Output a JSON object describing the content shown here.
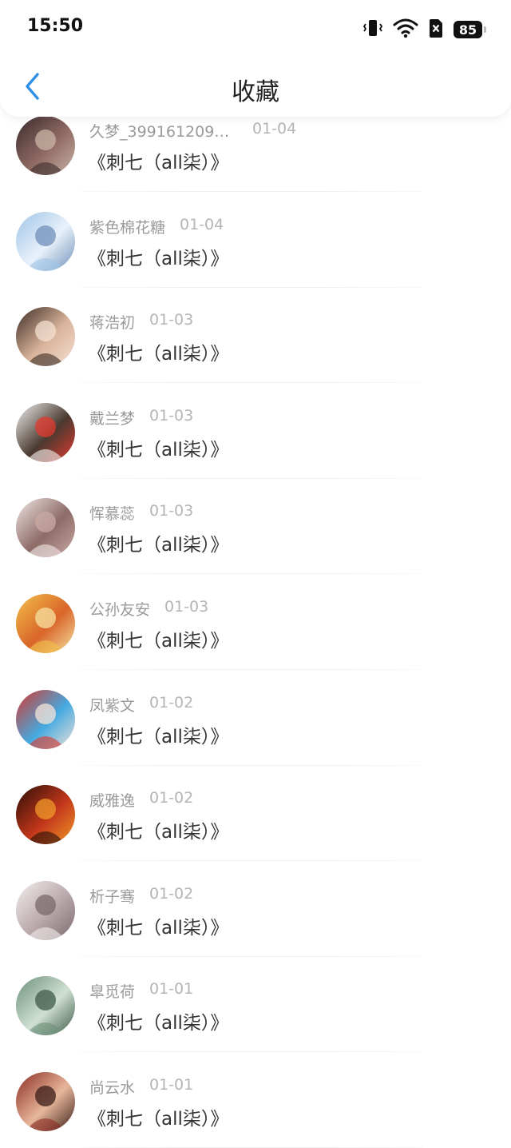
{
  "status_bar": {
    "time": "15:50",
    "battery": "85"
  },
  "header": {
    "title": "收藏"
  },
  "items": [
    {
      "username": "久梦_3991612093...",
      "date": "01-04",
      "title": "《刺七（all柒）》",
      "colors": [
        "#3a2a2c",
        "#8f6a63",
        "#c9b4a6"
      ]
    },
    {
      "username": "紫色棉花糖",
      "date": "01-04",
      "title": "《刺七（all柒）》",
      "colors": [
        "#9fc4e6",
        "#e8f1fb",
        "#6f8fb8"
      ]
    },
    {
      "username": "蒋浩初",
      "date": "01-03",
      "title": "《刺七（all柒）》",
      "colors": [
        "#3b2a22",
        "#d9b49c",
        "#f4e0d2"
      ]
    },
    {
      "username": "戴兰梦",
      "date": "01-03",
      "title": "《刺七（all柒）》",
      "colors": [
        "#f3f3f3",
        "#4a3a30",
        "#e23b2f"
      ]
    },
    {
      "username": "恽慕蕊",
      "date": "01-03",
      "title": "《刺七（all柒）》",
      "colors": [
        "#f2e6e6",
        "#8d6c68",
        "#c9a9a3"
      ]
    },
    {
      "username": "公孙友安",
      "date": "01-03",
      "title": "《刺七（all柒）》",
      "colors": [
        "#f2c14a",
        "#d9652a",
        "#f7e1a0"
      ]
    },
    {
      "username": "凤紫文",
      "date": "01-02",
      "title": "《刺七（all柒）》",
      "colors": [
        "#d8372c",
        "#45a9e0",
        "#f4e4d8"
      ]
    },
    {
      "username": "威雅逸",
      "date": "01-02",
      "title": "《刺七（all柒）》",
      "colors": [
        "#2a0f08",
        "#c2361a",
        "#f09a2a"
      ]
    },
    {
      "username": "析子骞",
      "date": "01-02",
      "title": "《刺七（all柒）》",
      "colors": [
        "#f3eeee",
        "#b9a8ab",
        "#7a6a6e"
      ]
    },
    {
      "username": "皐觅荷",
      "date": "01-01",
      "title": "《刺七（all柒）》",
      "colors": [
        "#6c8f7a",
        "#cfe0d2",
        "#3e5a48"
      ]
    },
    {
      "username": "尚云水",
      "date": "01-01",
      "title": "《刺七（all柒）》",
      "colors": [
        "#8b2a22",
        "#e7b79a",
        "#3a1d18"
      ]
    }
  ],
  "icons": {
    "back": "chevron-left-icon",
    "vibrate": "vibrate-icon",
    "wifi": "wifi-icon",
    "sim": "no-sim-icon"
  },
  "accent_color": "#2f8fe6"
}
